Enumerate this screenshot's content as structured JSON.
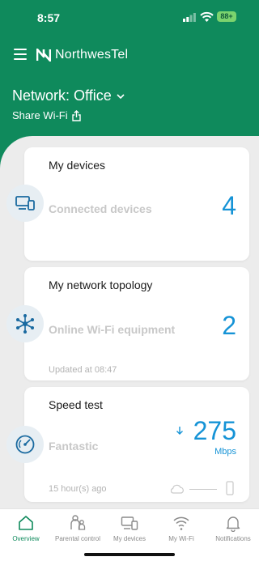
{
  "status": {
    "time": "8:57",
    "battery": "88+"
  },
  "header": {
    "brand": "NorthwesTel",
    "network_title": "Network: Office",
    "share_label": "Share Wi-Fi"
  },
  "cards": {
    "devices": {
      "title": "My devices",
      "desc": "Connected devices",
      "value": "4"
    },
    "topology": {
      "title": "My network topology",
      "desc": "Online Wi-Fi equipment",
      "value": "2",
      "updated": "Updated at 08:47"
    },
    "speed": {
      "title": "Speed test",
      "desc": "Fantastic",
      "value": "275",
      "unit": "Mbps",
      "ago": "15 hour(s) ago"
    }
  },
  "nav": {
    "items": [
      {
        "label": "Overview",
        "icon": "home-icon"
      },
      {
        "label": "Parental control",
        "icon": "family-icon"
      },
      {
        "label": "My devices",
        "icon": "devices-icon"
      },
      {
        "label": "My Wi-Fi",
        "icon": "wifi-icon"
      },
      {
        "label": "Notifications",
        "icon": "bell-icon"
      }
    ]
  },
  "colors": {
    "brand_green": "#0f8a5c",
    "accent_blue": "#1593d6"
  }
}
